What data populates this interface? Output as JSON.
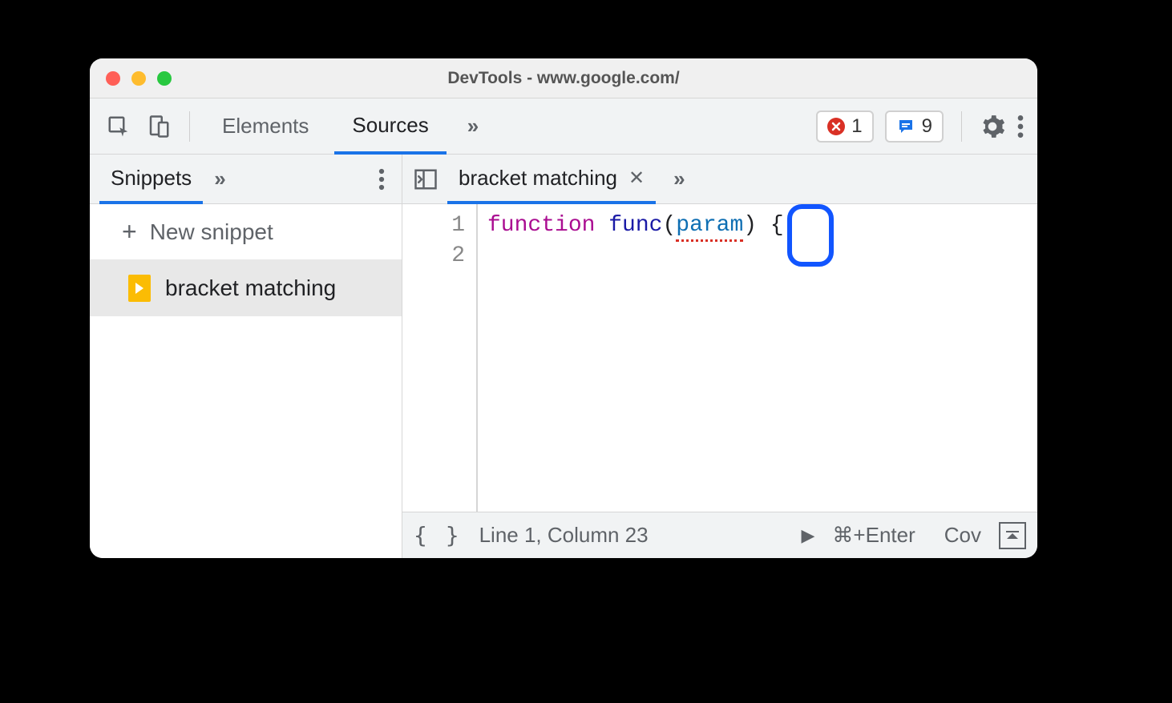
{
  "window": {
    "title": "DevTools - www.google.com/"
  },
  "main_tabs": {
    "elements": "Elements",
    "sources": "Sources",
    "overflow": "»"
  },
  "counters": {
    "errors": "1",
    "messages": "9"
  },
  "sidebar": {
    "active_tab": "Snippets",
    "overflow": "»",
    "new_snippet_label": "New snippet",
    "items": [
      {
        "label": "bracket matching"
      }
    ]
  },
  "editor": {
    "active_tab": "bracket matching",
    "overflow": "»",
    "gutter": [
      "1",
      "2"
    ],
    "code": {
      "keyword": "function",
      "func_name": "func",
      "open_paren": "(",
      "param": "param",
      "close_paren": ")",
      "brace": "{"
    }
  },
  "statusbar": {
    "format": "{ }",
    "position": "Line 1, Column 23",
    "run_shortcut": "⌘+Enter",
    "coverage": "Cov"
  }
}
